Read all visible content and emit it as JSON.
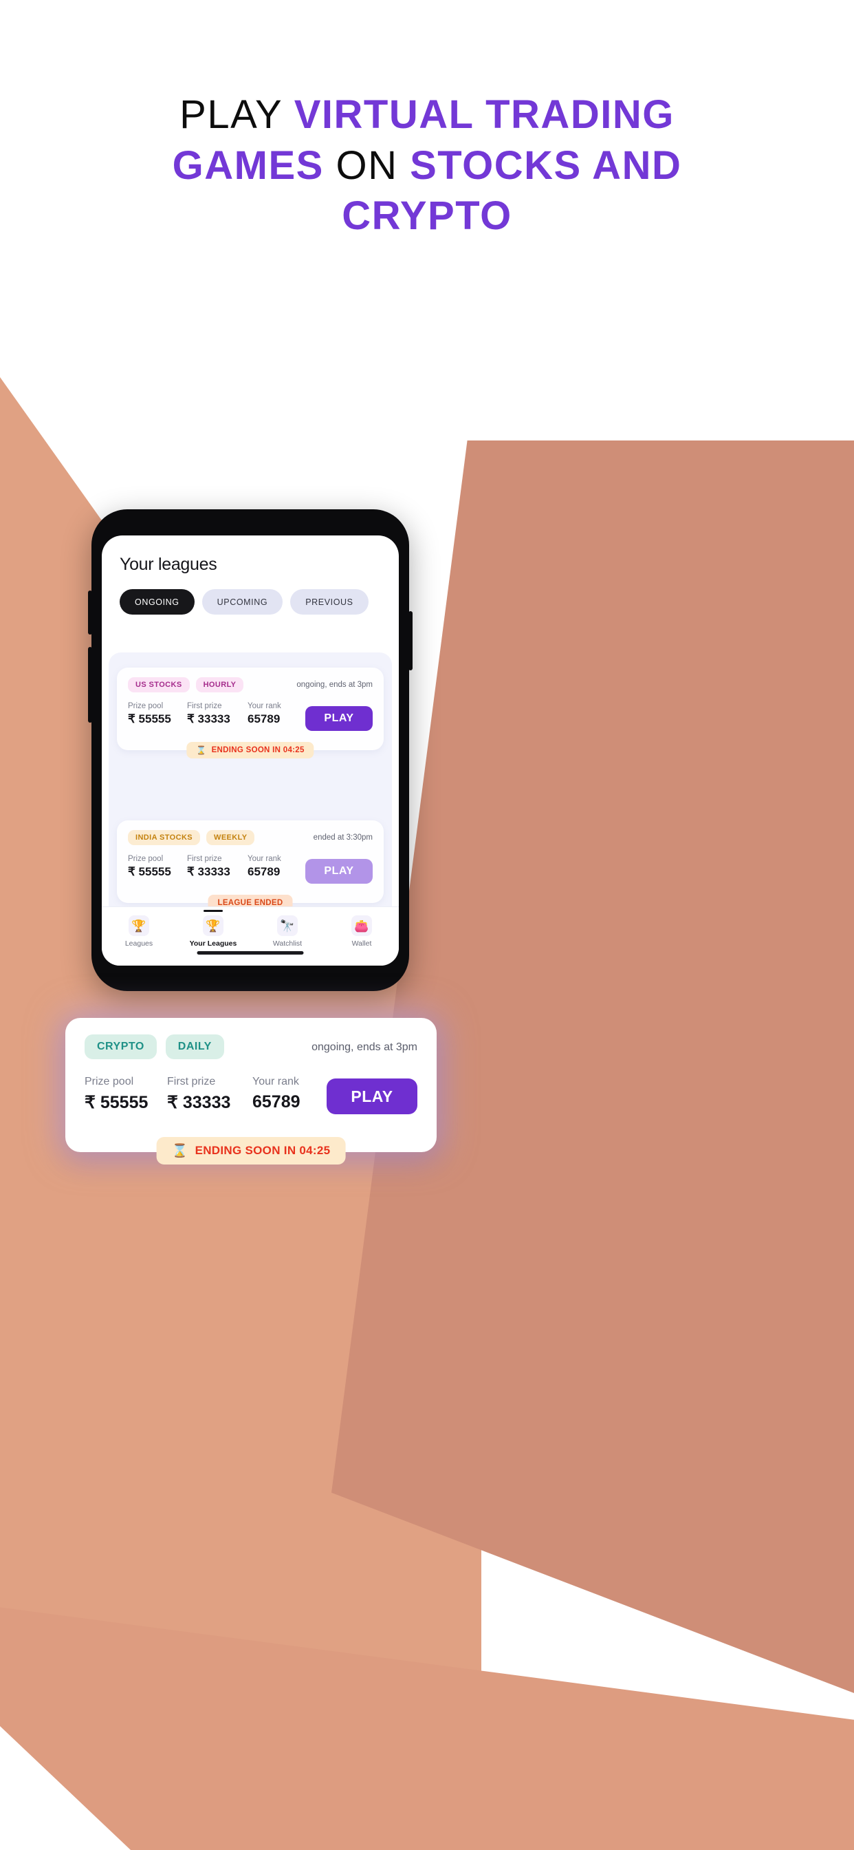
{
  "promo": {
    "headline_lines": [
      [
        {
          "text": "PLAY ",
          "style": "plain"
        },
        {
          "text": "VIRTUAL TRADING",
          "style": "accent"
        }
      ],
      [
        {
          "text": "GAMES",
          "style": "accent"
        },
        {
          "text": " ON ",
          "style": "plain"
        },
        {
          "text": "STOCKS AND",
          "style": "accent"
        }
      ],
      [
        {
          "text": "CRYPTO",
          "style": "accent"
        }
      ]
    ],
    "accent_color": "#7338d6",
    "plain_color": "#0d0d0d",
    "background_shape_colors": [
      "#e0a183",
      "#cf8e77",
      "#dd9c80"
    ]
  },
  "app": {
    "screen_title": "Your leagues",
    "tabs": [
      {
        "label": "ONGOING",
        "active": true
      },
      {
        "label": "UPCOMING",
        "active": false
      },
      {
        "label": "PREVIOUS",
        "active": false
      }
    ],
    "stat_labels": {
      "prize_pool": "Prize pool",
      "first_prize": "First prize",
      "your_rank": "Your rank"
    },
    "cards": [
      {
        "badges": [
          {
            "label": "US STOCKS",
            "color": "pink"
          },
          {
            "label": "HOURLY",
            "color": "pink"
          }
        ],
        "status": "ongoing, ends at 3pm",
        "prize_pool": "₹ 55555",
        "first_prize": "₹ 33333",
        "your_rank": "65789",
        "action_label": "PLAY",
        "action_disabled": false,
        "pill": {
          "icon": "hourglass-icon",
          "glyph": "⌛",
          "label": "ENDING SOON IN 04:25",
          "style": "ending"
        }
      },
      {
        "badges": [
          {
            "label": "CRYPTO",
            "color": "mint"
          },
          {
            "label": "DAILY",
            "color": "mint"
          }
        ],
        "status": "ongoing, ends at 3pm",
        "prize_pool": "₹ 55555",
        "first_prize": "₹ 33333",
        "your_rank": "65789",
        "action_label": "PLAY",
        "action_disabled": false,
        "pill": {
          "icon": "hourglass-icon",
          "glyph": "⌛",
          "label": "ENDING SOON IN 04:25",
          "style": "ending"
        }
      },
      {
        "badges": [
          {
            "label": "INDIA STOCKS",
            "color": "amber"
          },
          {
            "label": "WEEKLY",
            "color": "amber"
          }
        ],
        "status": "ended at 3:30pm",
        "prize_pool": "₹ 55555",
        "first_prize": "₹ 33333",
        "your_rank": "65789",
        "action_label": "PLAY",
        "action_disabled": true,
        "pill": {
          "icon": "none",
          "glyph": "",
          "label": "LEAGUE ENDED",
          "style": "ended"
        }
      }
    ],
    "bottom_nav": [
      {
        "label": "Leagues",
        "icon": "trophy-icon",
        "glyph": "🏆",
        "active": false
      },
      {
        "label": "Your Leagues",
        "icon": "trophy-icon",
        "glyph": "🏆",
        "active": true
      },
      {
        "label": "Watchlist",
        "icon": "binoculars-icon",
        "glyph": "🔭",
        "active": false
      },
      {
        "label": "Wallet",
        "icon": "wallet-icon",
        "glyph": "👛",
        "active": false
      }
    ]
  }
}
